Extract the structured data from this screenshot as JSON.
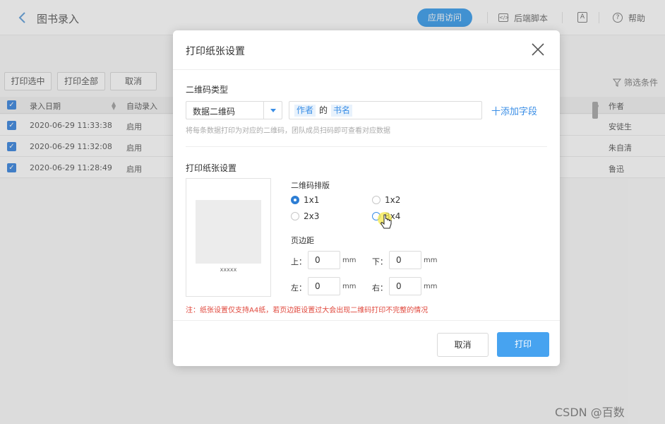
{
  "app": {
    "title": "图书录入",
    "publish_label": "应用访问",
    "script_label": "后端脚本",
    "help_label": "帮助"
  },
  "toolbar": {
    "print_selected": "打印选中",
    "print_all": "打印全部",
    "cancel": "取消",
    "filter": "筛选条件"
  },
  "grid": {
    "headers": [
      "录入日期",
      "自动录入",
      "作者"
    ],
    "rows": [
      {
        "date": "2020-06-29 11:33:38",
        "status": "启用",
        "author": "安徒生"
      },
      {
        "date": "2020-06-29 11:32:08",
        "status": "启用",
        "author": "朱自清"
      },
      {
        "date": "2020-06-29 11:28:49",
        "status": "启用",
        "author": "鲁迅"
      }
    ]
  },
  "dialog": {
    "title": "打印纸张设置",
    "qr_type_title": "二维码类型",
    "qr_type_value": "数据二维码",
    "field_tag_1": "作者",
    "field_joiner": "的",
    "field_tag_2": "书名",
    "add_field": "十添加字段",
    "hint": "将每条数据打印为对应的二维码，团队成员扫码即可查看对应数据",
    "paper_title": "打印纸张设置",
    "paper_caption": "xxxxx",
    "layout_title": "二维码排版",
    "layouts": [
      {
        "label": "1x1",
        "selected": true
      },
      {
        "label": "1x2",
        "selected": false
      },
      {
        "label": "2x3",
        "selected": false
      },
      {
        "label": "3x4",
        "selected": false
      }
    ],
    "margin_title": "页边距",
    "margins": {
      "top_label": "上：",
      "top_value": "0",
      "bottom_label": "下：",
      "bottom_value": "0",
      "left_label": "左：",
      "left_value": "0",
      "right_label": "右：",
      "right_value": "0",
      "unit": "mm"
    },
    "warning": "注：纸张设置仅支持A4纸，若页边距设置过大会出现二维码打印不完整的情况",
    "cancel_label": "取消",
    "print_label": "打印"
  },
  "watermark": "CSDN @百数",
  "colors": {
    "accent": "#3a8ee6",
    "primary_button": "#47a3f0",
    "warning": "#e0483d"
  }
}
